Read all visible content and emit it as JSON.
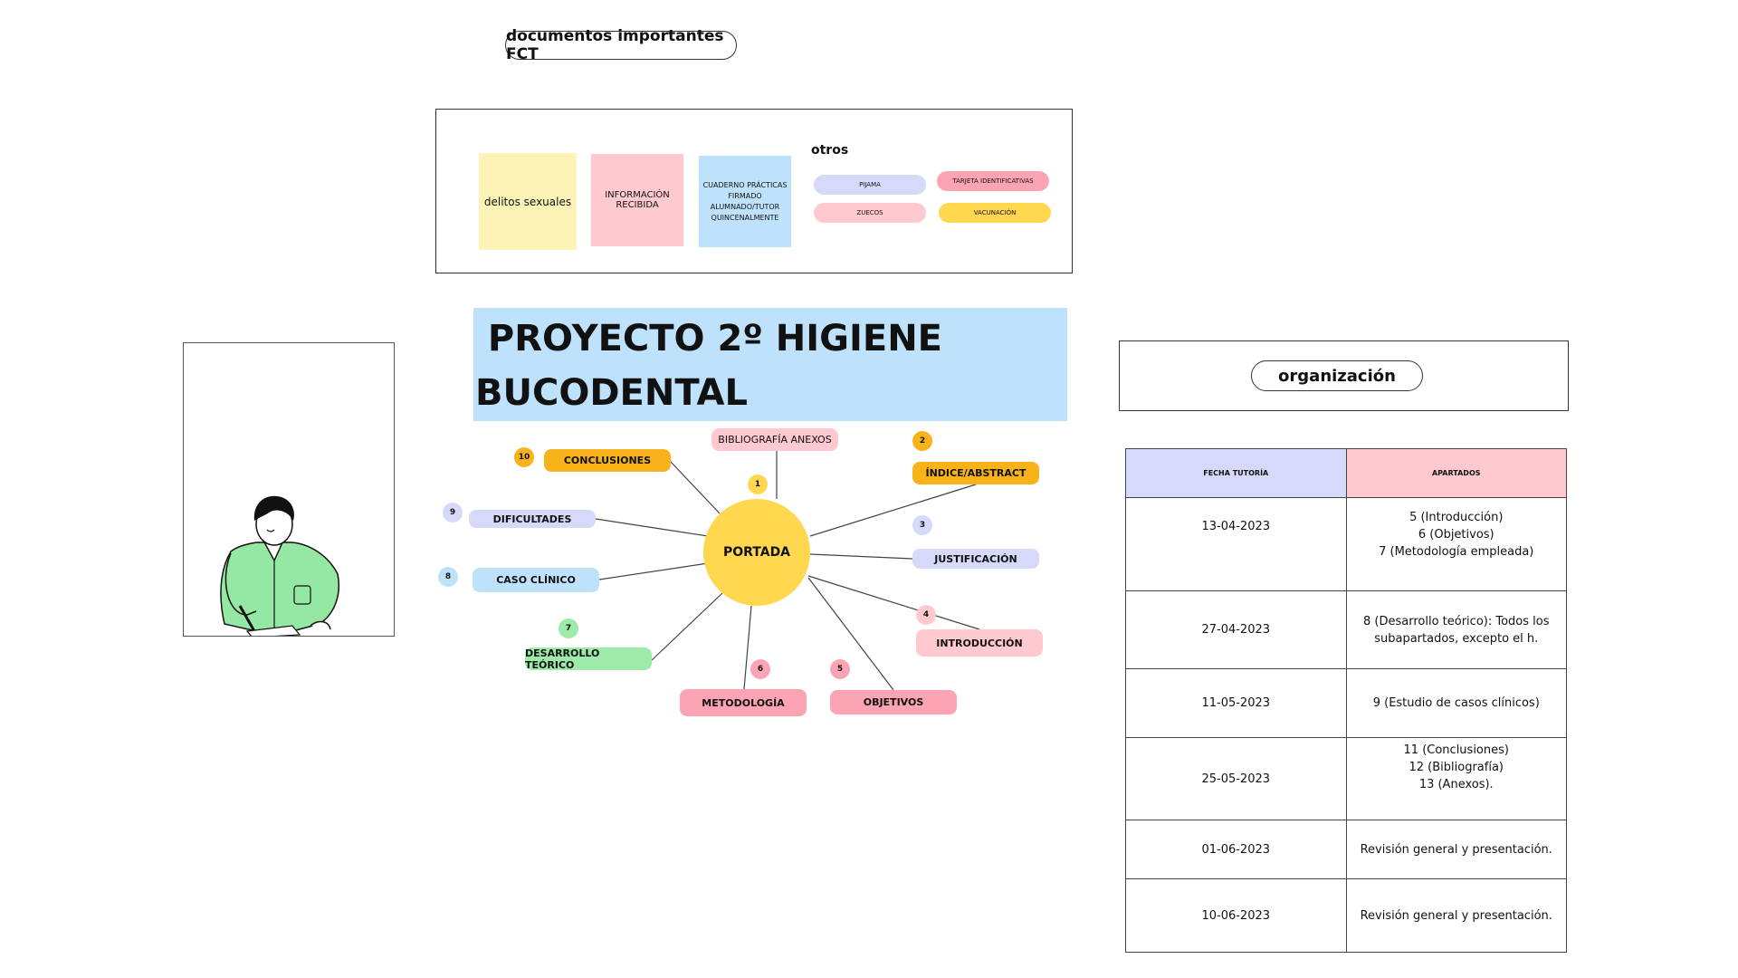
{
  "header": {
    "title": "documentos importantes FCT"
  },
  "docs": {
    "notes": [
      {
        "label": "delitos sexuales",
        "color": "#fdf3b7"
      },
      {
        "label": "INFORMACIÓN RECIBIDA",
        "color": "#ffc9d0"
      },
      {
        "label": "CUADERNO PRÁCTICAS FIRMADO ALUMNADO/TUTOR QUINCENALMENTE",
        "color": "#bfe2fc"
      }
    ],
    "otros_label": "otros",
    "otros": [
      {
        "label": "PIJAMA",
        "color": "#d7d9fb"
      },
      {
        "label": "TARJETA IDENTIFICATIVAS",
        "color": "#fda4b4"
      },
      {
        "label": "ZUECOS",
        "color": "#ffc9d0"
      },
      {
        "label": "VACUNACIÓN",
        "color": "#ffd84f"
      }
    ]
  },
  "project": {
    "title_line1": " PROYECTO 2º HIGIENE",
    "title_line2": "BUCODENTAL"
  },
  "mindmap": {
    "center": "PORTADA",
    "center_color": "#ffd84f",
    "nodes": [
      {
        "num": "1",
        "label": "BIBLIOGRAFÍA ANEXOS",
        "color": "#ffc9d0",
        "num_color": "#ffd84f"
      },
      {
        "num": "2",
        "label": "ÍNDICE/ABSTRACT",
        "color": "#f8b21a",
        "num_color": "#f8b21a"
      },
      {
        "num": "3",
        "label": "JUSTIFICACIÓN",
        "color": "#d7d9fb",
        "num_color": "#d7d9fb"
      },
      {
        "num": "4",
        "label": "INTRODUCCIÓN",
        "color": "#ffc9d0",
        "num_color": "#ffc9d0"
      },
      {
        "num": "5",
        "label": "OBJETIVOS",
        "color": "#fda4b4",
        "num_color": "#fda4b4"
      },
      {
        "num": "6",
        "label": "METODOLOGÍA",
        "color": "#fda4b4",
        "num_color": "#fda4b4"
      },
      {
        "num": "7",
        "label": "DESARROLLO TEÓRICO",
        "color": "#9eeaa9",
        "num_color": "#9eeaa9"
      },
      {
        "num": "8",
        "label": "CASO CLÍNICO",
        "color": "#bfe2fc",
        "num_color": "#bfe2fc"
      },
      {
        "num": "9",
        "label": "DIFICULTADES",
        "color": "#d7d9fb",
        "num_color": "#d7d9fb"
      },
      {
        "num": "10",
        "label": "CONCLUSIONES",
        "color": "#f8b21a",
        "num_color": "#f8b21a"
      }
    ]
  },
  "organization": {
    "title": "organización",
    "headers": [
      "FECHA TUTORÍA",
      "APARTADOS"
    ],
    "header_colors": [
      "#d7d9fb",
      "#ffc9d0"
    ],
    "rows": [
      {
        "date": "13-04-2023",
        "items": "5 (Introducción)\n6 (Objetivos)\n7 (Metodología empleada)"
      },
      {
        "date": "27-04-2023",
        "items": "8 (Desarrollo teórico): Todos los\nsubapartados, excepto el h."
      },
      {
        "date": "11-05-2023",
        "items": "9 (Estudio de casos clínicos)"
      },
      {
        "date": "25-05-2023",
        "items": "11 (Conclusiones)\n12 (Bibliografía)\n13 (Anexos)."
      },
      {
        "date": "01-06-2023",
        "items": "Revisión general y presentación."
      },
      {
        "date": "10-06-2023",
        "items": "Revisión general y presentación."
      }
    ]
  }
}
